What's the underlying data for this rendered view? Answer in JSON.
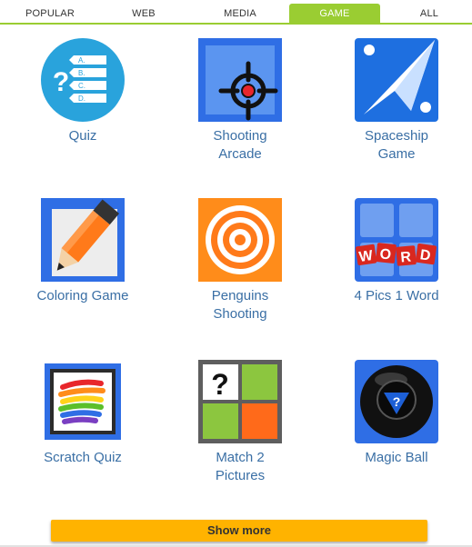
{
  "tabs": [
    {
      "label": "POPULAR",
      "active": false
    },
    {
      "label": "WEB",
      "active": false
    },
    {
      "label": "MEDIA",
      "active": false
    },
    {
      "label": "GAME",
      "active": true
    },
    {
      "label": "ALL",
      "active": false
    }
  ],
  "colors": {
    "accent": "#9acd32",
    "link": "#3a6fa5",
    "show_more_bg": "#ffb300"
  },
  "items": [
    {
      "label": "Quiz",
      "icon": "quiz-icon",
      "icon_options": [
        "A.",
        "B.",
        "C.",
        "D."
      ],
      "icon_glyph": "?"
    },
    {
      "label": "Shooting\nArcade",
      "icon": "crosshair-icon"
    },
    {
      "label": "Spaceship\nGame",
      "icon": "spaceship-icon"
    },
    {
      "label": "Coloring Game",
      "icon": "pencil-icon"
    },
    {
      "label": "Penguins\nShooting",
      "icon": "target-icon"
    },
    {
      "label": "4 Pics 1 Word",
      "icon": "word-tiles-icon",
      "icon_letters": [
        "W",
        "O",
        "R",
        "D"
      ]
    },
    {
      "label": "Scratch Quiz",
      "icon": "rainbow-scratch-icon"
    },
    {
      "label": "Match 2\nPictures",
      "icon": "match-tiles-icon",
      "icon_glyph": "?"
    },
    {
      "label": "Magic Ball",
      "icon": "magic-8-ball-icon",
      "icon_glyph": "?"
    }
  ],
  "show_more": "Show more"
}
